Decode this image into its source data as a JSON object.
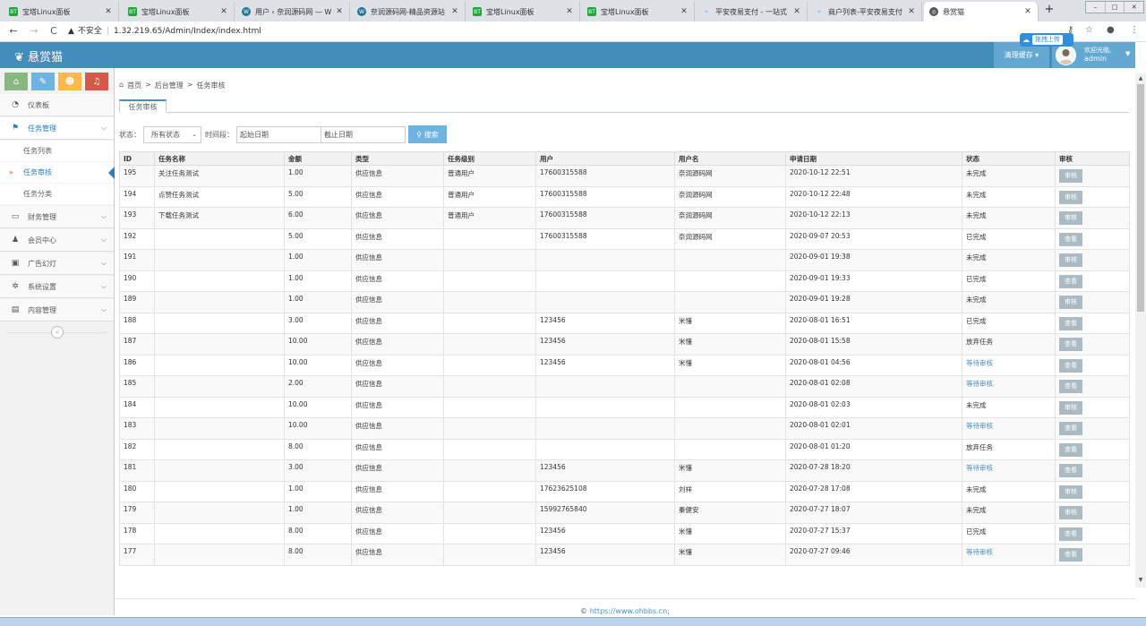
{
  "browser": {
    "tabs": [
      {
        "label": "宝塔Linux面板",
        "icon": "bt"
      },
      {
        "label": "宝塔Linux面板",
        "icon": "bt"
      },
      {
        "label": "用户 ‹ 奈润源码网 — W",
        "icon": "wp"
      },
      {
        "label": "奈润源码网-精品资源站",
        "icon": "wp"
      },
      {
        "label": "宝塔Linux面板",
        "icon": "bt"
      },
      {
        "label": "宝塔Linux面板",
        "icon": "bt"
      },
      {
        "label": "平安夜易支付 - 一站式",
        "icon": "leaf"
      },
      {
        "label": "商户列表-平安夜易支付",
        "icon": "leaf"
      },
      {
        "label": "悬赏猫",
        "icon": "globe"
      }
    ],
    "new_tab": "+",
    "window_controls": [
      "–",
      "□",
      "✕"
    ],
    "security": "不安全",
    "url": "1.32.219.65/Admin/Index/index.html"
  },
  "upload_badge": {
    "label": "拖拽上传"
  },
  "header": {
    "brand": "悬赏猫",
    "clear_cache": "清理缓存",
    "welcome_line1": "欢迎光临,",
    "welcome_line2": "admin"
  },
  "sidebar": {
    "shortcut_colors": [
      "#87b87f",
      "#6fb3e0",
      "#ffb752",
      "#d15b47"
    ],
    "dashboard": "仪表板",
    "task_mgmt": "任务管理",
    "task_list": "任务列表",
    "task_audit": "任务审核",
    "task_category": "任务分类",
    "finance": "财务管理",
    "members": "会员中心",
    "ads": "广告幻灯",
    "settings": "系统设置",
    "content": "内容管理"
  },
  "breadcrumb": {
    "home": "首页",
    "parent": "后台管理",
    "current": "任务审核"
  },
  "content_tab": "任务审核",
  "filter": {
    "status_label": "状态：",
    "status_value": "所有状态",
    "period_label": "时间段：",
    "start_placeholder": "起始日期",
    "end_placeholder": "截止日期",
    "search_button": "搜索"
  },
  "table": {
    "headers": [
      "ID",
      "任务名称",
      "金额",
      "类型",
      "任务级别",
      "用户",
      "用户名",
      "申请日期",
      "状态",
      "审核"
    ],
    "rows": [
      {
        "id": "195",
        "name": "关注任务测试",
        "amount": "1.00",
        "type": "供应信息",
        "level": "普通用户",
        "user": "17600315588",
        "username": "奈润源码网",
        "date": "2020-10-12 22:51",
        "status": "未完成",
        "action": "审核"
      },
      {
        "id": "194",
        "name": "点赞任务测试",
        "amount": "5.00",
        "type": "供应信息",
        "level": "普通用户",
        "user": "17600315588",
        "username": "奈润源码网",
        "date": "2020-10-12 22:48",
        "status": "未完成",
        "action": "审核"
      },
      {
        "id": "193",
        "name": "下载任务测试",
        "amount": "6.00",
        "type": "供应信息",
        "level": "普通用户",
        "user": "17600315588",
        "username": "奈润源码网",
        "date": "2020-10-12 22:13",
        "status": "未完成",
        "action": "审核"
      },
      {
        "id": "192",
        "name": "",
        "amount": "5.00",
        "type": "供应信息",
        "level": "",
        "user": "17600315588",
        "username": "奈润源码网",
        "date": "2020-09-07 20:53",
        "status": "已完成",
        "action": "查看"
      },
      {
        "id": "191",
        "name": "",
        "amount": "1.00",
        "type": "供应信息",
        "level": "",
        "user": "",
        "username": "",
        "date": "2020-09-01 19:38",
        "status": "未完成",
        "action": "审核"
      },
      {
        "id": "190",
        "name": "",
        "amount": "1.00",
        "type": "供应信息",
        "level": "",
        "user": "",
        "username": "",
        "date": "2020-09-01 19:33",
        "status": "已完成",
        "action": "查看"
      },
      {
        "id": "189",
        "name": "",
        "amount": "1.00",
        "type": "供应信息",
        "level": "",
        "user": "",
        "username": "",
        "date": "2020-09-01 19:28",
        "status": "未完成",
        "action": "审核"
      },
      {
        "id": "188",
        "name": "",
        "amount": "3.00",
        "type": "供应信息",
        "level": "",
        "user": "123456",
        "username": "米懂",
        "date": "2020-08-01 16:51",
        "status": "已完成",
        "action": "查看"
      },
      {
        "id": "187",
        "name": "",
        "amount": "10.00",
        "type": "供应信息",
        "level": "",
        "user": "123456",
        "username": "米懂",
        "date": "2020-08-01 15:58",
        "status": "放弃任务",
        "action": "查看"
      },
      {
        "id": "186",
        "name": "",
        "amount": "10.00",
        "type": "供应信息",
        "level": "",
        "user": "123456",
        "username": "米懂",
        "date": "2020-08-01 04:56",
        "status": "等待审核",
        "action": "查看"
      },
      {
        "id": "185",
        "name": "",
        "amount": "2.00",
        "type": "供应信息",
        "level": "",
        "user": "",
        "username": "",
        "date": "2020-08-01 02:08",
        "status": "等待审核",
        "action": "查看"
      },
      {
        "id": "184",
        "name": "",
        "amount": "10.00",
        "type": "供应信息",
        "level": "",
        "user": "",
        "username": "",
        "date": "2020-08-01 02:03",
        "status": "未完成",
        "action": "审核"
      },
      {
        "id": "183",
        "name": "",
        "amount": "10.00",
        "type": "供应信息",
        "level": "",
        "user": "",
        "username": "",
        "date": "2020-08-01 02:01",
        "status": "等待审核",
        "action": "查看"
      },
      {
        "id": "182",
        "name": "",
        "amount": "8.00",
        "type": "供应信息",
        "level": "",
        "user": "",
        "username": "",
        "date": "2020-08-01 01:20",
        "status": "放弃任务",
        "action": "查看"
      },
      {
        "id": "181",
        "name": "",
        "amount": "3.00",
        "type": "供应信息",
        "level": "",
        "user": "123456",
        "username": "米懂",
        "date": "2020-07-28 18:20",
        "status": "等待审核",
        "action": "查看"
      },
      {
        "id": "180",
        "name": "",
        "amount": "1.00",
        "type": "供应信息",
        "level": "",
        "user": "17623625108",
        "username": "刘祥",
        "date": "2020-07-28 17:08",
        "status": "未完成",
        "action": "审核"
      },
      {
        "id": "179",
        "name": "",
        "amount": "1.00",
        "type": "供应信息",
        "level": "",
        "user": "15992765840",
        "username": "秦健安",
        "date": "2020-07-27 18:07",
        "status": "未完成",
        "action": "审核"
      },
      {
        "id": "178",
        "name": "",
        "amount": "8.00",
        "type": "供应信息",
        "level": "",
        "user": "123456",
        "username": "米懂",
        "date": "2020-07-27 15:37",
        "status": "已完成",
        "action": "查看"
      },
      {
        "id": "177",
        "name": "",
        "amount": "8.00",
        "type": "供应信息",
        "level": "",
        "user": "123456",
        "username": "米懂",
        "date": "2020-07-27 09:46",
        "status": "等待审核",
        "action": "查看"
      }
    ]
  },
  "footer": {
    "copyright": "©",
    "link": "https://www.ohbbs.cn;"
  }
}
